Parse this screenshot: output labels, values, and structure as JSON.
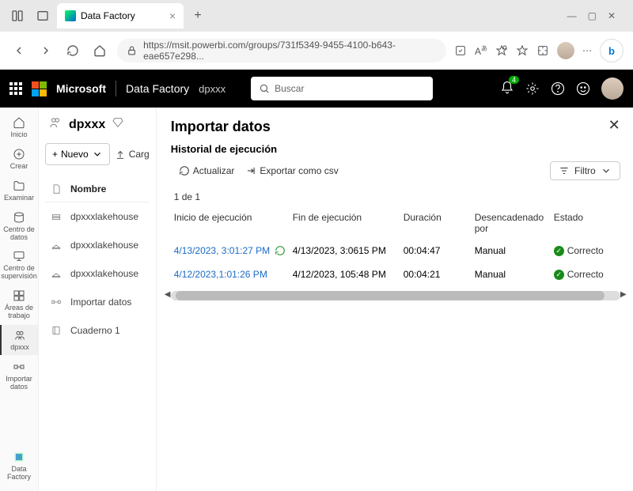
{
  "browser": {
    "tab_title": "Data Factory",
    "url": "https://msit.powerbi.com/groups/731f5349-9455-4100-b643-eae657e298..."
  },
  "header": {
    "brand": "Microsoft",
    "product": "Data Factory",
    "breadcrumb": "dpxxx",
    "search_placeholder": "Buscar",
    "notif_count": "4"
  },
  "left_rail": {
    "items": [
      {
        "label": "Inicio"
      },
      {
        "label": "Crear"
      },
      {
        "label": "Examinar"
      },
      {
        "label": "Centro de datos"
      },
      {
        "label": "Centro de supervisión"
      },
      {
        "label": "Áreas de trabajo"
      },
      {
        "label": "dpxxx"
      },
      {
        "label": "Importar datos"
      }
    ],
    "bottom_label": "Data Factory"
  },
  "side_panel": {
    "workspace_name": "dpxxx",
    "btn_new": "Nuevo",
    "btn_upload": "Carg",
    "col_name": "Nombre",
    "items": [
      {
        "name": "dpxxxlakehouse"
      },
      {
        "name": "dpxxxlakehouse"
      },
      {
        "name": "dpxxxlakehouse"
      },
      {
        "name": "Importar datos"
      },
      {
        "name": "Cuaderno 1"
      }
    ]
  },
  "main": {
    "title": "Importar datos",
    "subtitle": "Historial de ejecución",
    "refresh": "Actualizar",
    "export_csv": "Exportar como csv",
    "filter": "Filtro",
    "pager": "1 de 1",
    "columns": {
      "start": "Inicio de ejecución",
      "end": "Fin de ejecución",
      "duration": "Duración",
      "triggered": "Desencadenado por",
      "status": "Estado"
    },
    "rows": [
      {
        "start": "4/13/2023, 3:01:27 PM",
        "end": "4/13/2023, 3:0615 PM",
        "duration": "00:04:47",
        "triggered": "Manual",
        "status": "Correcto"
      },
      {
        "start": "4/12/2023,1:01:26 PM",
        "end": "4/12/2023, 105:48 PM",
        "duration": "00:04:21",
        "triggered": "Manual",
        "status": "Correcto"
      }
    ]
  }
}
